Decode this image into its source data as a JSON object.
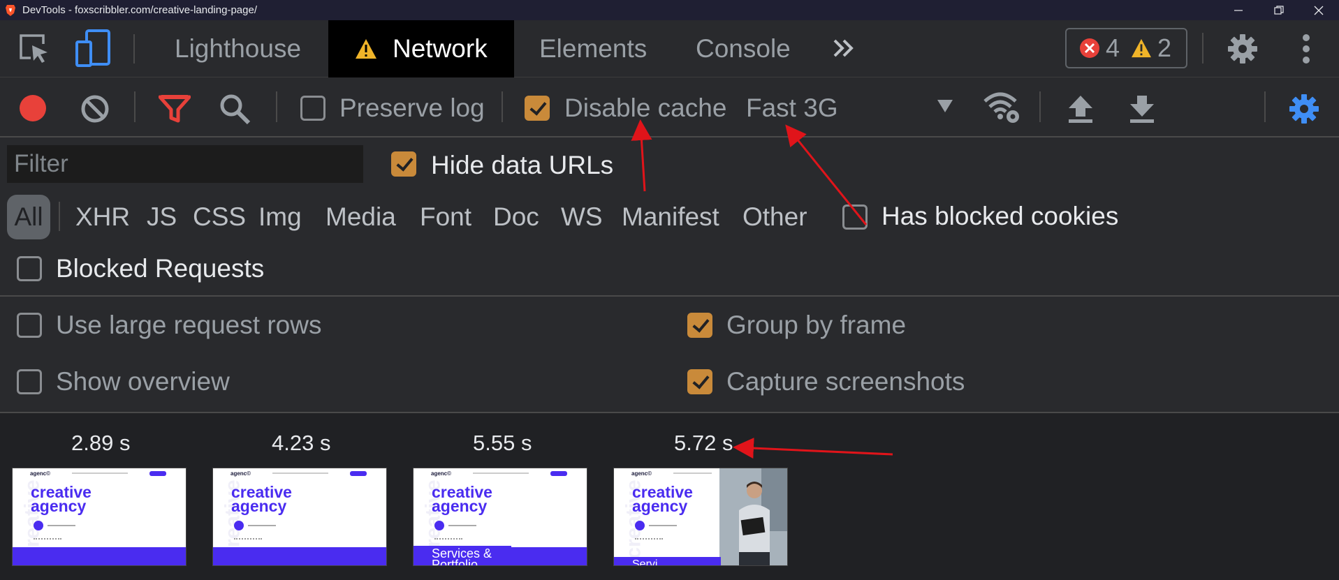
{
  "titlebar": {
    "title": "DevTools - foxscribbler.com/creative-landing-page/",
    "icons": [
      "brave-icon",
      "minimize-icon",
      "restore-icon",
      "close-icon"
    ]
  },
  "tabs": [
    {
      "label": "Lighthouse",
      "active": false
    },
    {
      "label": "Network",
      "active": true,
      "icon": "warning-icon"
    },
    {
      "label": "Elements",
      "active": false
    },
    {
      "label": "Console",
      "active": false
    }
  ],
  "issues": {
    "errors": "4",
    "warnings": "2"
  },
  "toolbar": {
    "preserve_log": {
      "label": "Preserve log",
      "checked": false
    },
    "disable_cache": {
      "label": "Disable cache",
      "checked": true
    },
    "throttling": "Fast 3G"
  },
  "filter": {
    "placeholder": "Filter",
    "hide_data_urls": {
      "label": "Hide data URLs",
      "checked": true
    },
    "types": [
      "All",
      "XHR",
      "JS",
      "CSS",
      "Img",
      "Media",
      "Font",
      "Doc",
      "WS",
      "Manifest",
      "Other"
    ],
    "has_blocked_cookies": {
      "label": "Has blocked cookies",
      "checked": false
    },
    "blocked_requests": {
      "label": "Blocked Requests",
      "checked": false
    }
  },
  "settings": {
    "use_large_rows": {
      "label": "Use large request rows",
      "checked": false
    },
    "show_overview": {
      "label": "Show overview",
      "checked": false
    },
    "group_by_frame": {
      "label": "Group by frame",
      "checked": true
    },
    "capture_screenshots": {
      "label": "Capture screenshots",
      "checked": true
    }
  },
  "screenshots": [
    {
      "time": "2.89 s",
      "band_text": ""
    },
    {
      "time": "4.23 s",
      "band_text": ""
    },
    {
      "time": "5.55 s",
      "band_text": "Services & Portfolio"
    },
    {
      "time": "5.72 s",
      "band_text": "Servi"
    }
  ],
  "thumb_content": {
    "logo": "agenc©",
    "headline_1": "creative",
    "headline_2": "agency",
    "vertical": "creative"
  },
  "colors": {
    "accent_checkbox": "#c98a3a",
    "record": "#e8413a",
    "filter_active": "#e8413a",
    "settings_active": "#3f8ef5",
    "annotation": "#e0141a"
  }
}
